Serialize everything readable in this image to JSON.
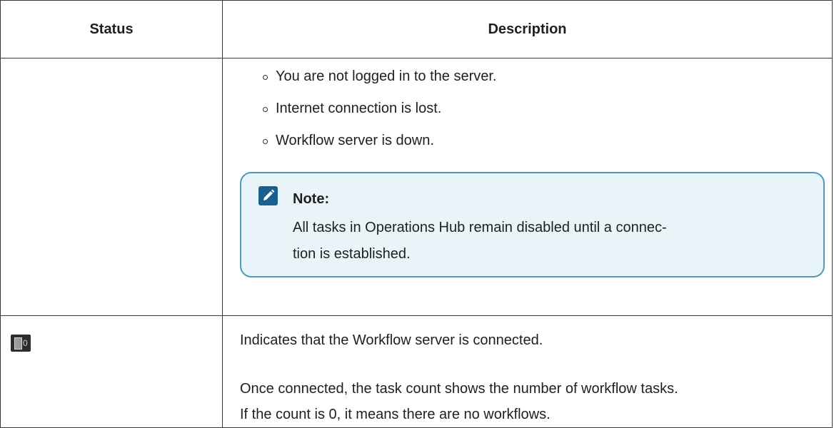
{
  "table": {
    "headers": {
      "status": "Status",
      "description": "Description"
    },
    "row1": {
      "bullets": [
        "You are not logged in to the server.",
        "Internet connection is lost.",
        "Workflow server is down."
      ],
      "note": {
        "title": "Note:",
        "text_line1": "All tasks in Operations Hub remain disabled until a connec-",
        "text_line2": "tion is established.",
        "icon": "pencil-note-icon",
        "background_color": "#e9f4f8",
        "border_color": "#4f9bb7",
        "icon_color": "#1a5f8e"
      }
    },
    "row2": {
      "status_icon": {
        "name": "workflow-task-icon",
        "count": "0"
      },
      "paragraph1": "Indicates that the Workflow server is connected.",
      "paragraph2_line1": "Once connected, the task count shows the number of workflow tasks.",
      "paragraph2_line2": "If the count is 0, it means there are no workflows."
    }
  }
}
